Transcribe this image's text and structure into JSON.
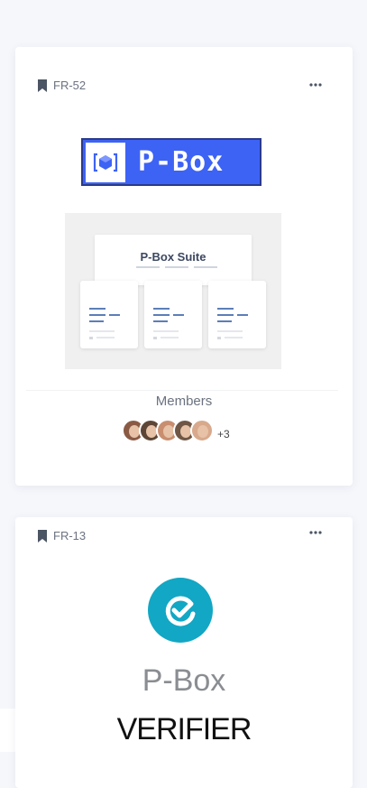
{
  "cards": [
    {
      "tag": "FR-52",
      "logo_text": "P-Box",
      "preview_title": "P-Box Suite",
      "members_label": "Members",
      "members_more": "+3",
      "avatar_colors": [
        "#8a5a44",
        "#5e4636",
        "#c98e6f",
        "#6f5645",
        "#d8a98c"
      ]
    },
    {
      "tag": "FR-13",
      "title": "P-Box",
      "subtitle": "VERIFIER"
    }
  ],
  "colors": {
    "logo_blue": "#3d63f5",
    "verifier_teal": "#12a7c4"
  }
}
